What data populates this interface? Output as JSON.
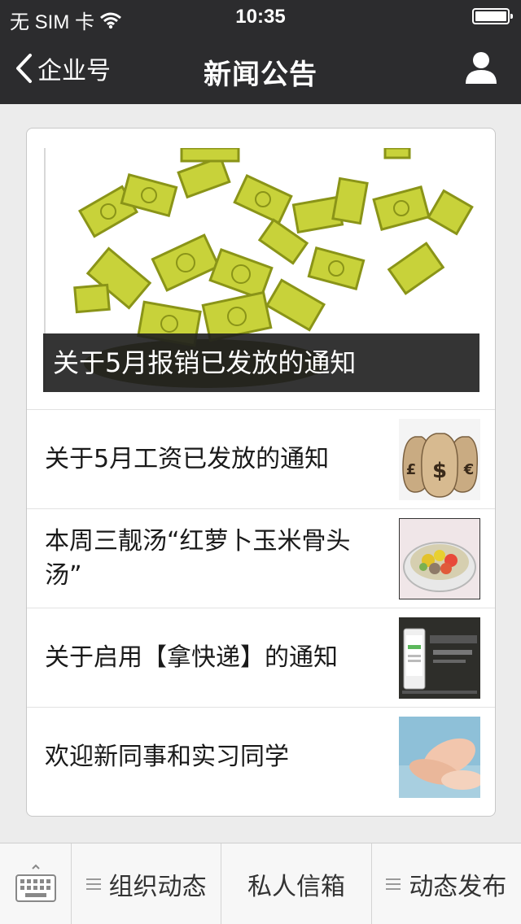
{
  "status_bar": {
    "carrier": "无 SIM 卡",
    "time": "10:35",
    "icons": [
      "wifi-icon",
      "battery-icon"
    ]
  },
  "nav": {
    "back_label": "企业号",
    "title": "新闻公告",
    "profile_icon": "person-icon"
  },
  "feature": {
    "caption": "关于5月报销已发放的通知",
    "image": "money-rain-image"
  },
  "articles": [
    {
      "title": "关于5月工资已发放的通知",
      "thumb": "money-bags-image"
    },
    {
      "title": "本周三靓汤“红萝卜玉米骨头汤”",
      "thumb": "soup-bowl-image"
    },
    {
      "title": "关于启用【拿快递】的通知",
      "thumb": "app-promo-image"
    },
    {
      "title": "欢迎新同事和实习同学",
      "thumb": "handshake-image"
    }
  ],
  "tab_bar": {
    "keyboard_icon": "keyboard-icon",
    "tabs": [
      {
        "label": "组织动态",
        "has_menu_icon": true
      },
      {
        "label": "私人信箱",
        "has_menu_icon": false
      },
      {
        "label": "动态发布",
        "has_menu_icon": true
      }
    ]
  },
  "colors": {
    "nav_bg": "#2c2c2e",
    "page_bg": "#ececec",
    "money_green": "#c8d23a"
  }
}
